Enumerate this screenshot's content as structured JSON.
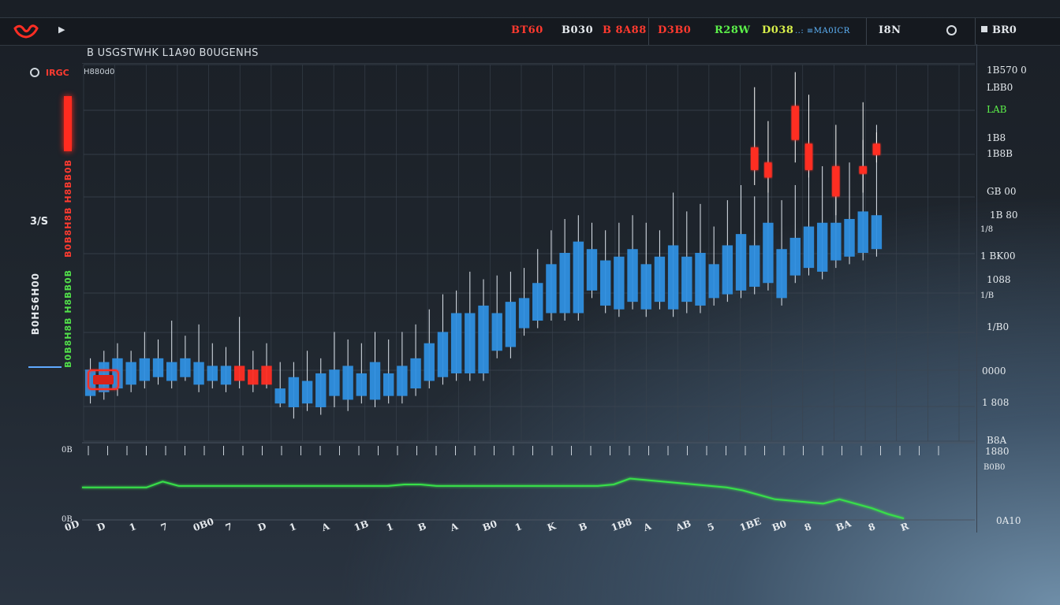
{
  "topbar": {
    "tickers": [
      {
        "label": "BT60",
        "color": "#ff3a2f"
      },
      {
        "label": "B030",
        "color": "#e6eaee"
      },
      {
        "label": "B 8A88",
        "color": "#ff3a2f"
      },
      {
        "label": "D3B0",
        "color": "#ff3a2f"
      },
      {
        "label": "R28W",
        "color": "#5cf04a"
      },
      {
        "label": "D038",
        "color": "#d9f04a"
      },
      {
        "label": "..: ≡MA0ICR",
        "color": "#5fb7ff"
      },
      {
        "label": "I8N",
        "color": "#e6eaee"
      }
    ],
    "menu_label": "BR0"
  },
  "toolbar": {
    "title": "B USGSTWHK  L1A90 B0UGENHS"
  },
  "left_panel": {
    "symbol": "IRGC",
    "symbol_sub": "H880d0",
    "pair": "3/S",
    "labels": [
      {
        "text": "B0B8H8B H8BB0B",
        "color": "#ff3b30"
      },
      {
        "text": "B0B8H8B H8BB0B",
        "color": "#52e04a"
      },
      {
        "text": "B0HS6H00",
        "color": "#e6eaee"
      }
    ]
  },
  "price_axis": [
    {
      "label": "1B570 0",
      "style": "normal"
    },
    {
      "label": "LBB0",
      "style": "normal"
    },
    {
      "label": "LAB",
      "style": "green"
    },
    {
      "label": "1B8",
      "style": "normal"
    },
    {
      "label": "1B8B",
      "style": "normal"
    },
    {
      "label": "GB 00",
      "style": "normal"
    },
    {
      "label": "1B 80",
      "style": "normal"
    },
    {
      "label": "1/8",
      "style": "small"
    },
    {
      "label": "1 BK00",
      "style": "normal"
    },
    {
      "label": "1088",
      "style": "normal"
    },
    {
      "label": "1/B",
      "style": "small"
    },
    {
      "label": "1/B0",
      "style": "normal"
    },
    {
      "label": "0000",
      "style": "normal"
    },
    {
      "label": "1 808",
      "style": "normal"
    },
    {
      "label": "B8A",
      "style": "normal"
    },
    {
      "label": "1880",
      "style": "normal"
    },
    {
      "label": "B0B0",
      "style": "small"
    },
    {
      "label": "0A10",
      "style": "normal"
    }
  ],
  "date_axis": [
    "0D",
    "D",
    "1",
    "7",
    "0B0",
    "7",
    "D",
    "1",
    "A",
    "1B",
    "1",
    "B",
    "A",
    "B0",
    "1",
    "K",
    "B",
    "1B8",
    "A",
    "AB",
    "5",
    "1BE",
    "B0",
    "8",
    "BA",
    "8",
    "R"
  ],
  "indicator_labels": [
    "0B",
    "0B"
  ],
  "colors": {
    "up": "#2f8fe0",
    "down": "#ff2e24",
    "indicator": "#38e04a"
  },
  "chart_data": {
    "type": "candlestick",
    "unit": "relative price index (0–100)",
    "ylim": [
      0,
      100
    ],
    "grid": true,
    "candles": [
      {
        "o": 12,
        "c": 19,
        "h": 22,
        "l": 10
      },
      {
        "o": 13,
        "c": 21,
        "h": 24,
        "l": 11
      },
      {
        "o": 14,
        "c": 22,
        "h": 26,
        "l": 12
      },
      {
        "o": 15,
        "c": 21,
        "h": 24,
        "l": 13
      },
      {
        "o": 16,
        "c": 22,
        "h": 29,
        "l": 14
      },
      {
        "o": 17,
        "c": 22,
        "h": 27,
        "l": 15
      },
      {
        "o": 16,
        "c": 21,
        "h": 32,
        "l": 14
      },
      {
        "o": 17,
        "c": 22,
        "h": 28,
        "l": 16
      },
      {
        "o": 15,
        "c": 21,
        "h": 31,
        "l": 13
      },
      {
        "o": 16,
        "c": 20,
        "h": 26,
        "l": 14
      },
      {
        "o": 15,
        "c": 20,
        "h": 25,
        "l": 13
      },
      {
        "o": 20,
        "c": 16,
        "h": 33,
        "l": 14
      },
      {
        "o": 19,
        "c": 15,
        "h": 24,
        "l": 13
      },
      {
        "o": 20,
        "c": 15,
        "h": 26,
        "l": 14
      },
      {
        "o": 10,
        "c": 14,
        "h": 21,
        "l": 9
      },
      {
        "o": 9,
        "c": 17,
        "h": 21,
        "l": 6
      },
      {
        "o": 10,
        "c": 16,
        "h": 24,
        "l": 8
      },
      {
        "o": 9,
        "c": 18,
        "h": 22,
        "l": 7
      },
      {
        "o": 12,
        "c": 19,
        "h": 29,
        "l": 9
      },
      {
        "o": 11,
        "c": 20,
        "h": 27,
        "l": 8
      },
      {
        "o": 12,
        "c": 18,
        "h": 26,
        "l": 10
      },
      {
        "o": 11,
        "c": 21,
        "h": 29,
        "l": 9
      },
      {
        "o": 12,
        "c": 18,
        "h": 27,
        "l": 10
      },
      {
        "o": 12,
        "c": 20,
        "h": 29,
        "l": 10
      },
      {
        "o": 14,
        "c": 22,
        "h": 31,
        "l": 12
      },
      {
        "o": 16,
        "c": 26,
        "h": 35,
        "l": 14
      },
      {
        "o": 17,
        "c": 29,
        "h": 39,
        "l": 15
      },
      {
        "o": 18,
        "c": 34,
        "h": 40,
        "l": 16
      },
      {
        "o": 18,
        "c": 34,
        "h": 45,
        "l": 16
      },
      {
        "o": 18,
        "c": 36,
        "h": 43,
        "l": 16
      },
      {
        "o": 24,
        "c": 34,
        "h": 44,
        "l": 22
      },
      {
        "o": 25,
        "c": 37,
        "h": 45,
        "l": 22
      },
      {
        "o": 30,
        "c": 38,
        "h": 46,
        "l": 28
      },
      {
        "o": 32,
        "c": 42,
        "h": 51,
        "l": 30
      },
      {
        "o": 34,
        "c": 47,
        "h": 56,
        "l": 32
      },
      {
        "o": 34,
        "c": 50,
        "h": 59,
        "l": 32
      },
      {
        "o": 34,
        "c": 53,
        "h": 60,
        "l": 32
      },
      {
        "o": 40,
        "c": 51,
        "h": 58,
        "l": 38
      },
      {
        "o": 36,
        "c": 48,
        "h": 56,
        "l": 34
      },
      {
        "o": 35,
        "c": 49,
        "h": 58,
        "l": 33
      },
      {
        "o": 37,
        "c": 51,
        "h": 60,
        "l": 35
      },
      {
        "o": 35,
        "c": 47,
        "h": 58,
        "l": 33
      },
      {
        "o": 37,
        "c": 49,
        "h": 56,
        "l": 35
      },
      {
        "o": 35,
        "c": 52,
        "h": 66,
        "l": 33
      },
      {
        "o": 37,
        "c": 49,
        "h": 61,
        "l": 34
      },
      {
        "o": 36,
        "c": 50,
        "h": 63,
        "l": 34
      },
      {
        "o": 38,
        "c": 47,
        "h": 57,
        "l": 36
      },
      {
        "o": 39,
        "c": 52,
        "h": 64,
        "l": 37
      },
      {
        "o": 40,
        "c": 55,
        "h": 68,
        "l": 38
      },
      {
        "o": 41,
        "c": 52,
        "h": 65,
        "l": 39
      },
      {
        "o": 42,
        "c": 58,
        "h": 70,
        "l": 40
      },
      {
        "o": 38,
        "c": 51,
        "h": 64,
        "l": 36
      },
      {
        "o": 44,
        "c": 54,
        "h": 68,
        "l": 42
      },
      {
        "o": 46,
        "c": 57,
        "h": 72,
        "l": 44
      },
      {
        "o": 45,
        "c": 58,
        "h": 73,
        "l": 43
      },
      {
        "o": 48,
        "c": 58,
        "h": 72,
        "l": 46
      },
      {
        "o": 49,
        "c": 59,
        "h": 74,
        "l": 47
      },
      {
        "o": 50,
        "c": 61,
        "h": 80,
        "l": 48
      },
      {
        "o": 51,
        "c": 60,
        "h": 84,
        "l": 49
      }
    ],
    "highlight_candles": [
      {
        "index": 49,
        "o": 72,
        "c": 78,
        "h": 94,
        "l": 68
      },
      {
        "index": 50,
        "o": 70,
        "c": 74,
        "h": 85,
        "l": 66
      },
      {
        "index": 52,
        "o": 80,
        "c": 89,
        "h": 98,
        "l": 74
      },
      {
        "index": 53,
        "o": 72,
        "c": 79,
        "h": 92,
        "l": 70
      },
      {
        "index": 55,
        "o": 65,
        "c": 73,
        "h": 84,
        "l": 60
      },
      {
        "index": 57,
        "o": 71,
        "c": 73,
        "h": 90,
        "l": 66
      },
      {
        "index": 58,
        "o": 76,
        "c": 79,
        "h": 82,
        "l": 74
      }
    ],
    "indicator": [
      22,
      22,
      22,
      22,
      22,
      26,
      23,
      23,
      23,
      23,
      23,
      23,
      23,
      23,
      23,
      23,
      23,
      23,
      23,
      23,
      24,
      24,
      23,
      23,
      23,
      23,
      23,
      23,
      23,
      23,
      23,
      23,
      23,
      24,
      28,
      27,
      26,
      25,
      24,
      23,
      22,
      20,
      17,
      14,
      13,
      12,
      11,
      14,
      11,
      8,
      4,
      1
    ]
  }
}
